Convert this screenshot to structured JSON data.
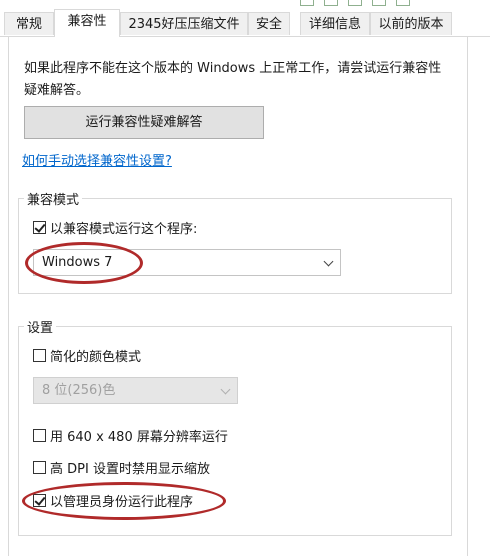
{
  "tabs": [
    {
      "label": "常规",
      "active": false
    },
    {
      "label": "兼容性",
      "active": true
    },
    {
      "label": "2345好压压缩文件",
      "active": false
    },
    {
      "label": "安全",
      "active": false
    },
    {
      "label": "详细信息",
      "active": false
    },
    {
      "label": "以前的版本",
      "active": false
    }
  ],
  "description": "如果此程序不能在这个版本的 Windows 上正常工作，请尝试运行兼容性疑难解答。",
  "troubleshoot_button": "运行兼容性疑难解答",
  "manual_link": "如何手动选择兼容性设置?",
  "compat_mode": {
    "title": "兼容模式",
    "checkbox_label": "以兼容模式运行这个程序:",
    "checked": true,
    "select_value": "Windows 7"
  },
  "settings": {
    "title": "设置",
    "reduced_color": {
      "label": "简化的颜色模式",
      "checked": false
    },
    "color_select_value": "8 位(256)色",
    "resolution_640": {
      "label": "用 640 x 480 屏幕分辨率运行",
      "checked": false
    },
    "high_dpi": {
      "label": "高 DPI 设置时禁用显示缩放",
      "checked": false
    },
    "run_as_admin": {
      "label": "以管理员身份运行此程序",
      "checked": true
    }
  },
  "colors": {
    "annotation": "#b02a2a",
    "link": "#0066cc",
    "button_bg": "#e1e1e1"
  }
}
